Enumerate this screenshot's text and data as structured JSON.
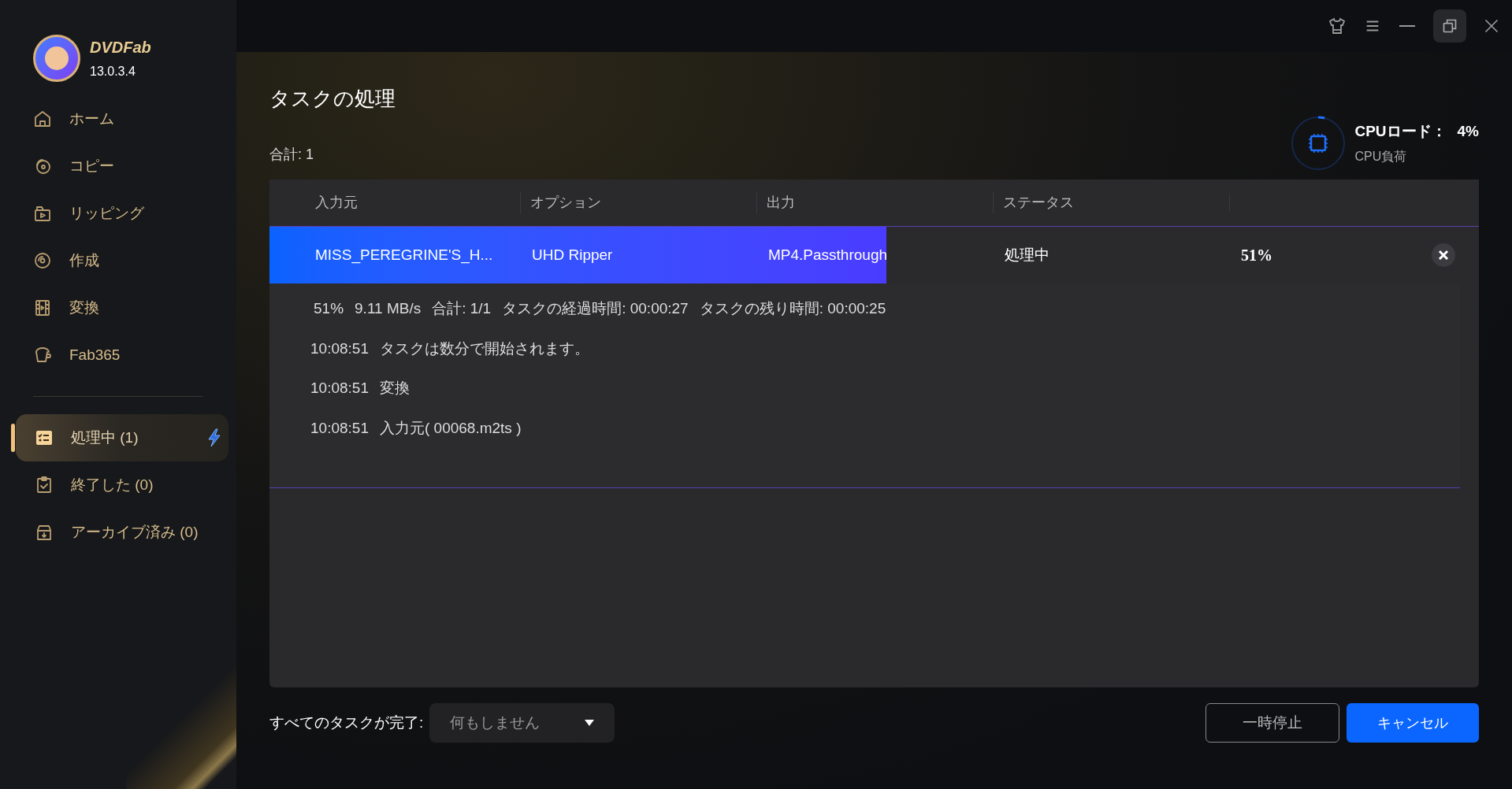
{
  "app": {
    "brand": "DVDFab",
    "version": "13.0.3.4"
  },
  "nav": [
    {
      "label": "ホーム",
      "kind": "home"
    },
    {
      "label": "コピー",
      "kind": "copy"
    },
    {
      "label": "リッピング",
      "kind": "rip"
    },
    {
      "label": "作成",
      "kind": "create"
    },
    {
      "label": "変換",
      "kind": "convert"
    },
    {
      "label": "Fab365",
      "kind": "store"
    }
  ],
  "queues": [
    {
      "label": "処理中 (1)",
      "kind": "processing",
      "selected": true,
      "boost": true
    },
    {
      "label": "終了した (0)",
      "kind": "finished",
      "selected": false,
      "boost": false
    },
    {
      "label": "アーカイブ済み (0)",
      "kind": "archived",
      "selected": false,
      "boost": false
    }
  ],
  "page": {
    "title": "タスクの処理",
    "total": "合計: 1"
  },
  "cpu": {
    "label": "CPUロード：",
    "value": "4%",
    "sublabel": "CPU負荷",
    "level": 0.04
  },
  "table": {
    "columns": [
      "入力元",
      "オプション",
      "出力",
      "ステータス"
    ],
    "rows": [
      {
        "source": "MISS_PEREGRINE'S_H...",
        "option": "UHD Ripper",
        "output": "MP4.Passthrough",
        "status": "処理中",
        "percent": "51%",
        "level": 0.51,
        "expanded": true
      }
    ]
  },
  "details": {
    "stats": [
      "51%",
      "9.11 MB/s",
      "合計: 1/1",
      "タスクの経過時間: 00:00:27",
      "タスクの残り時間: 00:00:25"
    ],
    "log": [
      {
        "time": "10:08:51",
        "message": "タスクは数分で開始されます。"
      },
      {
        "time": "10:08:51",
        "message": "変換"
      },
      {
        "time": "10:08:51",
        "message": "入力元( 00068.m2ts )"
      }
    ]
  },
  "footer": {
    "label": "すべてのタスクが完了:",
    "dropdown": "何もしません",
    "buttons": [
      {
        "label": "一時停止",
        "kind": "outline"
      },
      {
        "label": "キャンセル",
        "kind": "primary"
      }
    ]
  }
}
